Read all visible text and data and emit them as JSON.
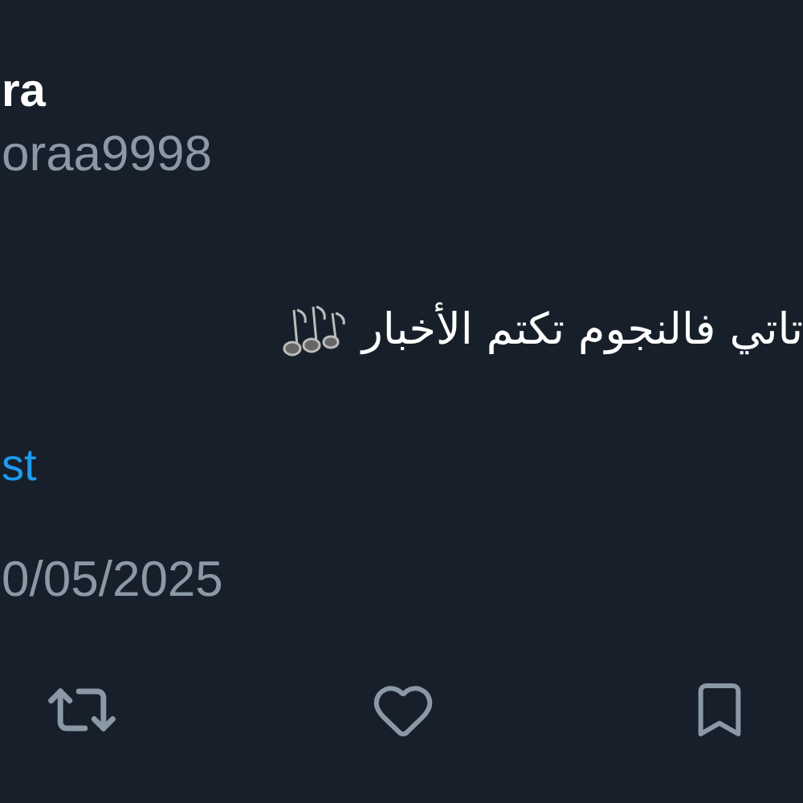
{
  "author": {
    "name": "ra",
    "handle": "oraa9998"
  },
  "tweet": {
    "text": "تاتي فالنجوم تكتم الأخبار"
  },
  "translate_link": "st",
  "date": "0/05/2025"
}
